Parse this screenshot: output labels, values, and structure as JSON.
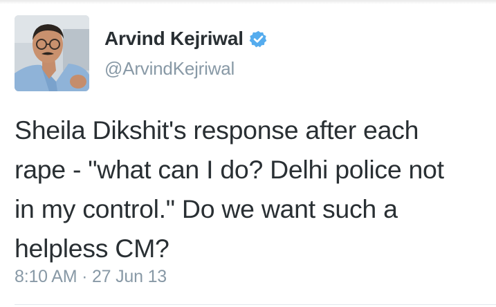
{
  "tweet": {
    "author": {
      "display_name": "Arvind Kejriwal",
      "handle": "@ArvindKejriwal",
      "verified": true,
      "verified_icon": "verified-badge-icon",
      "verified_color": "#55acee"
    },
    "text_lines": [
      "Sheila Dikshit's response after each",
      "rape - \"what can I do? Delhi police not",
      "in my control.\" Do we want such a",
      "helpless CM?"
    ],
    "time": "8:10 AM",
    "separator": "·",
    "date": "27 Jun 13"
  }
}
